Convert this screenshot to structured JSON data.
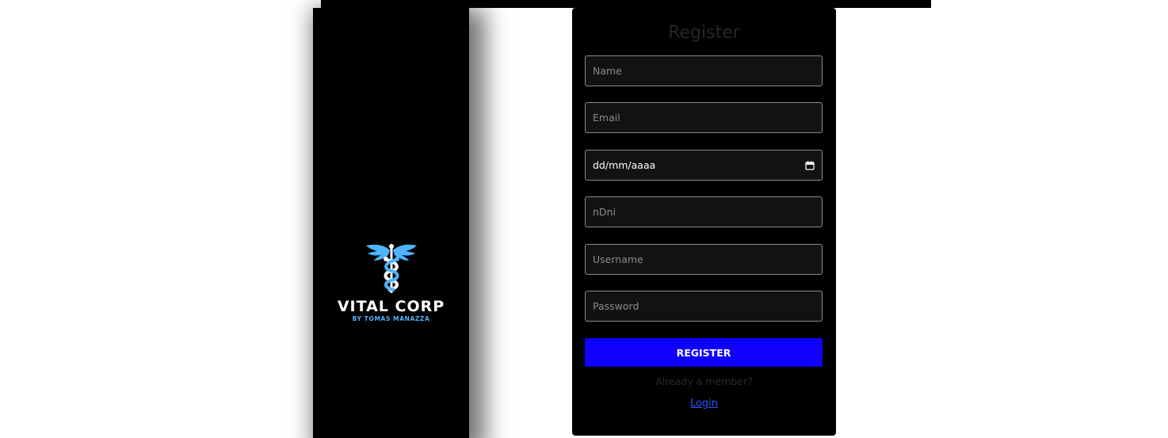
{
  "brand": {
    "name": "VITAL CORP",
    "tagline": "BY TOMAS MANAZZA",
    "logo_icon": "caduceus-icon",
    "accent_color": "#4fb3ff"
  },
  "form": {
    "title": "Register",
    "fields": {
      "name_placeholder": "Name",
      "email_placeholder": "Email",
      "date_value": "dd/mm/aaaa",
      "dni_placeholder": "nDni",
      "username_placeholder": "Username",
      "password_placeholder": "Password"
    },
    "submit_label": "REGISTER",
    "submit_color": "#1000ff",
    "member_prompt": "Already a member?",
    "login_label": "Login"
  }
}
